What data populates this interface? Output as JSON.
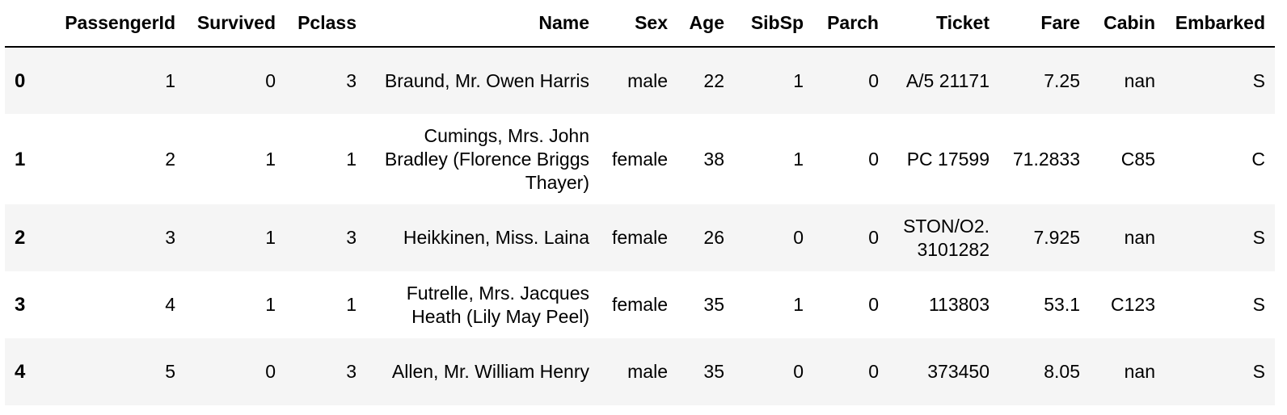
{
  "table": {
    "columns": [
      "PassengerId",
      "Survived",
      "Pclass",
      "Name",
      "Sex",
      "Age",
      "SibSp",
      "Parch",
      "Ticket",
      "Fare",
      "Cabin",
      "Embarked"
    ],
    "rows": [
      {
        "index": "0",
        "cells": [
          "1",
          "0",
          "3",
          "Braund, Mr. Owen Harris",
          "male",
          "22",
          "1",
          "0",
          "A/5 21171",
          "7.25",
          "nan",
          "S"
        ]
      },
      {
        "index": "1",
        "cells": [
          "2",
          "1",
          "1",
          "Cumings, Mrs. John Bradley (Florence Briggs Thayer)",
          "female",
          "38",
          "1",
          "0",
          "PC 17599",
          "71.2833",
          "C85",
          "C"
        ]
      },
      {
        "index": "2",
        "cells": [
          "3",
          "1",
          "3",
          "Heikkinen, Miss. Laina",
          "female",
          "26",
          "0",
          "0",
          "STON/O2. 3101282",
          "7.925",
          "nan",
          "S"
        ]
      },
      {
        "index": "3",
        "cells": [
          "4",
          "1",
          "1",
          "Futrelle, Mrs. Jacques Heath (Lily May Peel)",
          "female",
          "35",
          "1",
          "0",
          "113803",
          "53.1",
          "C123",
          "S"
        ]
      },
      {
        "index": "4",
        "cells": [
          "5",
          "0",
          "3",
          "Allen, Mr. William Henry",
          "male",
          "35",
          "0",
          "0",
          "373450",
          "8.05",
          "nan",
          "S"
        ]
      }
    ]
  },
  "colors": {
    "stripe": "#f5f5f5",
    "rule": "#000000"
  }
}
